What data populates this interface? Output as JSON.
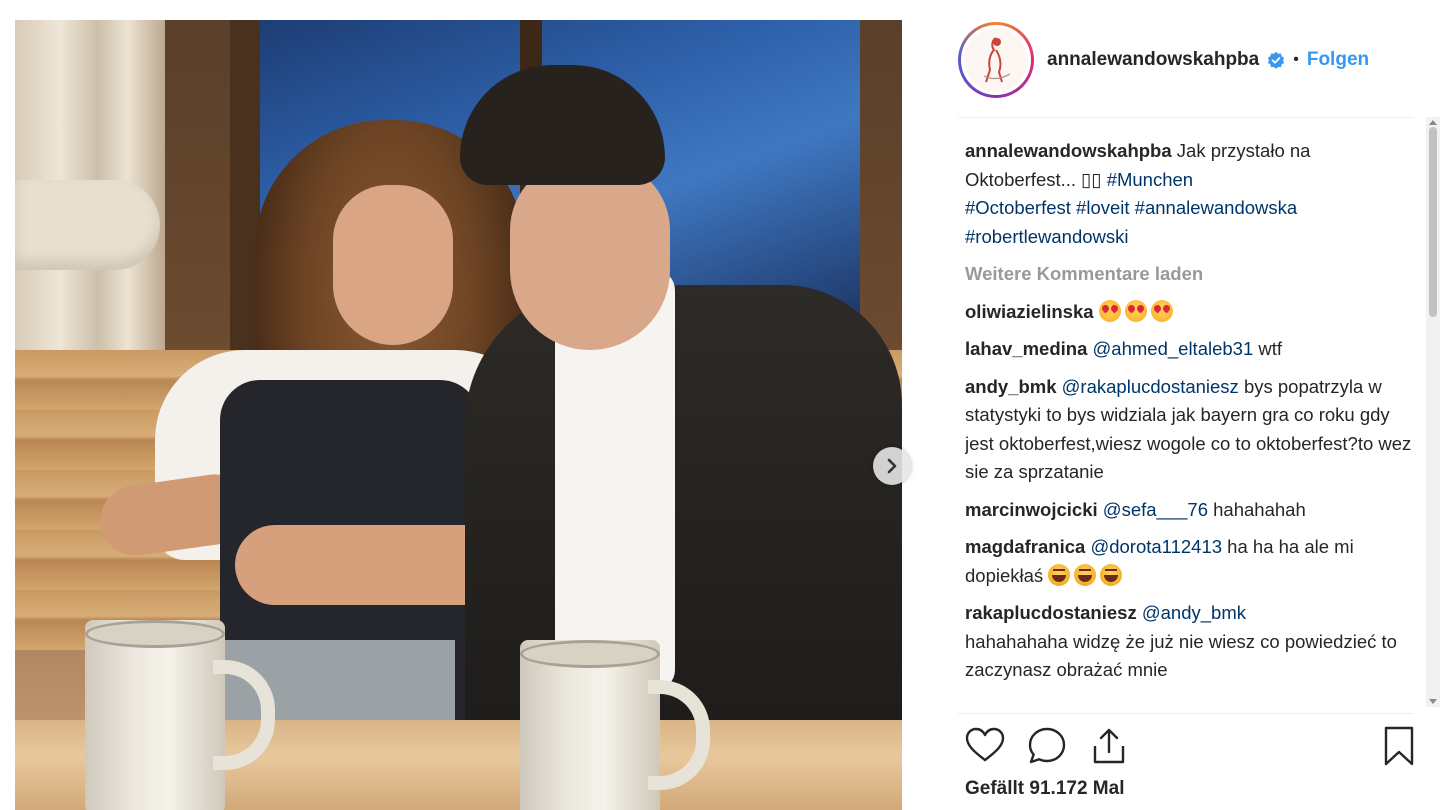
{
  "post": {
    "username": "annalewandowskahpba",
    "follow_label": "Folgen",
    "separator": "•",
    "avatar_label": "healthy plan by ann",
    "photo_caption_icon": "photo",
    "next_icon": "chevron-right-icon"
  },
  "caption": {
    "user": "annalewandowskahpba",
    "text": " Jak przystało na Oktoberfest... ▯▯ ",
    "tags": [
      "#Munchen",
      " #Octoberfest",
      " #loveit",
      " #annalewandowska",
      " #robertlewandowski"
    ]
  },
  "load_more": "Weitere Kommentare laden",
  "comments": [
    {
      "user": "oliwiazielinska",
      "mention": "",
      "text": ""
    },
    {
      "user": "lahav_medina",
      "mention": "@ahmed_eltaleb31",
      "text": " wtf"
    },
    {
      "user": "andy_bmk",
      "mention": "@rakaplucdostaniesz",
      "text": " bys popatrzyla w statystyki to bys widziala jak bayern gra co roku gdy jest oktoberfest,wiesz wogole co to oktoberfest?to wez sie za sprzatanie"
    },
    {
      "user": "marcinwojcicki",
      "mention": "@sefa___76",
      "text": " hahahahah"
    },
    {
      "user": "magdafranica",
      "mention": "@dorota112413",
      "text": " ha ha ha ale mi dopiekłaś "
    },
    {
      "user": "rakaplucdostaniesz",
      "mention": "@andy_bmk",
      "text": " hahahahaha widzę że już nie wiesz co powiedzieć to zaczynasz obrażać mnie"
    }
  ],
  "likes": "Gefällt 91.172 Mal",
  "colors": {
    "link": "#3897f0",
    "tag": "#003569",
    "muted": "#999999",
    "text": "#262626"
  }
}
